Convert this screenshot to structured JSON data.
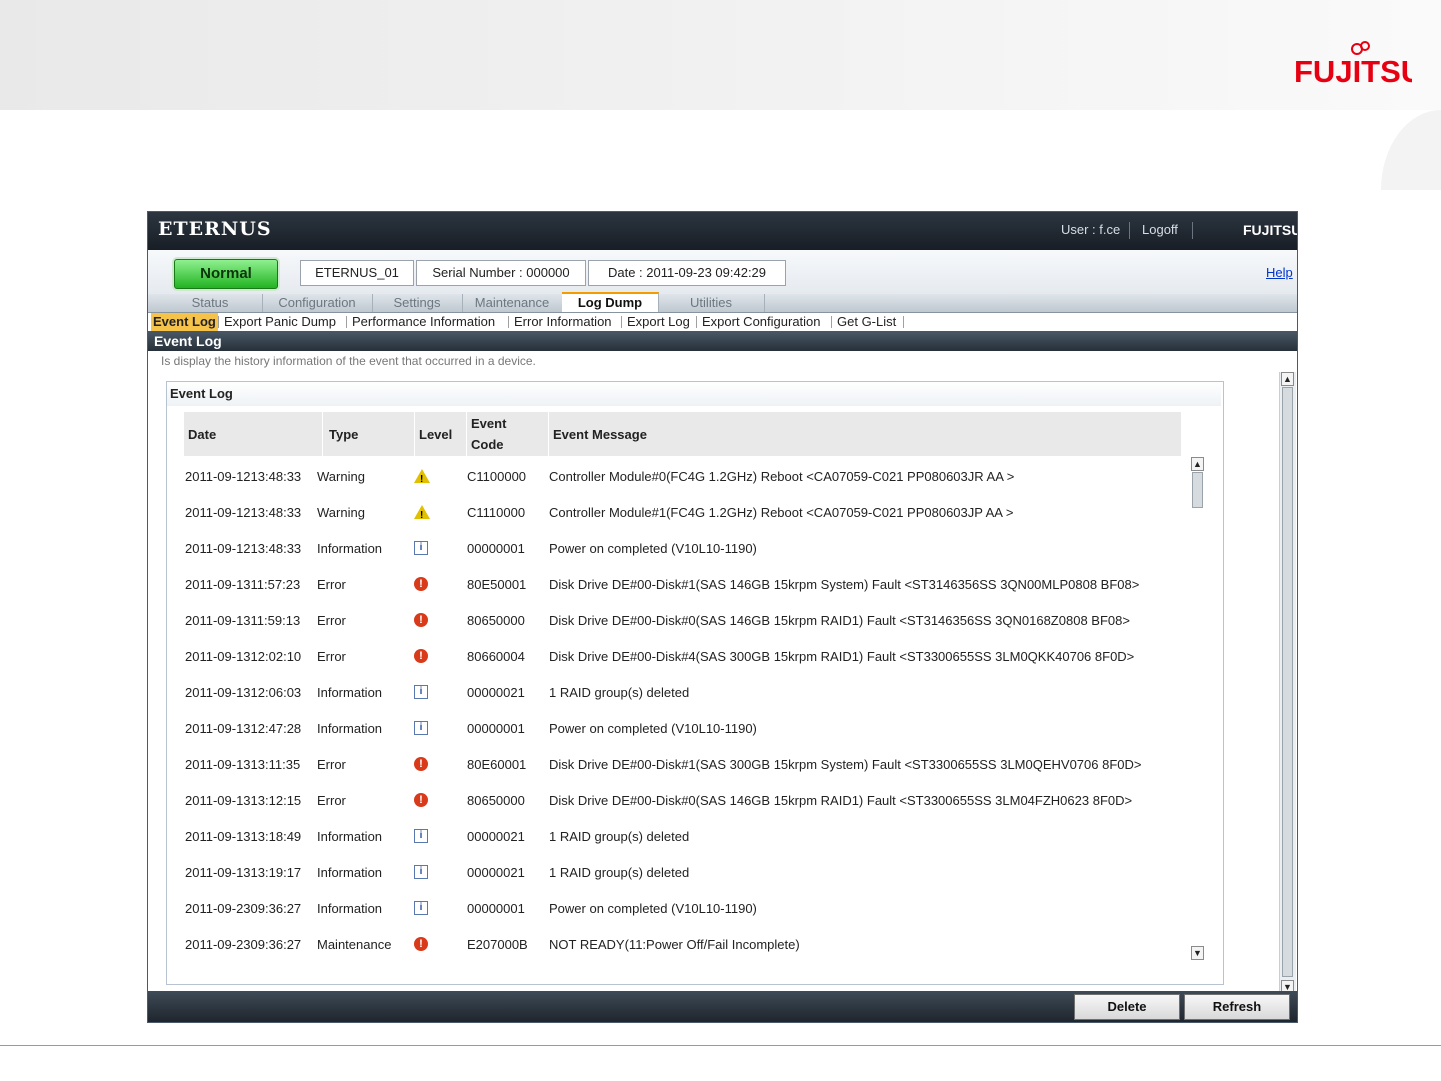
{
  "slide": {
    "logo": "FUJITSU"
  },
  "header": {
    "brand": "ETERNUS",
    "user": "User : f.ce",
    "logoff": "Logoff",
    "vendor": "FUJITSU"
  },
  "status": {
    "state": "Normal",
    "device": "ETERNUS_01",
    "serial": "Serial Number : 000000",
    "date": "Date : 2011-09-23 09:42:29",
    "help": "Help"
  },
  "tabs": [
    "Status",
    "Configuration",
    "Settings",
    "Maintenance",
    "Log Dump",
    "Utilities"
  ],
  "active_tab": "Log Dump",
  "subtabs": [
    "Event Log",
    "Export Panic Dump",
    "Performance Information",
    "Error Information",
    "Export Log",
    "Export Configuration",
    "Get G-List"
  ],
  "active_subtab": "Event Log",
  "section": {
    "title": "Event Log",
    "description": "Is display the history information of the event that occurred in a device."
  },
  "panel": {
    "title": "Event Log",
    "columns": {
      "date": "Date",
      "type": "Type",
      "level": "Level",
      "code_line1": "Event",
      "code_line2": "Code",
      "message": "Event Message"
    },
    "rows": [
      {
        "date1": "2011-09-12",
        "date2": "13:48:33",
        "type": "Warning",
        "level": "warning-icon",
        "code": "C1100000",
        "message": "Controller Module#0(FC4G 1.2GHz) Reboot <CA07059-C021 PP080603JR AA >"
      },
      {
        "date1": "2011-09-12",
        "date2": "13:48:33",
        "type": "Warning",
        "level": "warning-icon",
        "code": "C1110000",
        "message": "Controller Module#1(FC4G 1.2GHz) Reboot <CA07059-C021 PP080603JP AA >"
      },
      {
        "date1": "2011-09-12",
        "date2": "13:48:33",
        "type": "Information",
        "level": "info-icon",
        "code": "00000001",
        "message": "Power on completed (V10L10-1190)"
      },
      {
        "date1": "2011-09-13",
        "date2": "11:57:23",
        "type": "Error",
        "level": "error-icon",
        "code": "80E50001",
        "message": "Disk Drive DE#00-Disk#1(SAS 146GB 15krpm System) Fault <ST3146356SS 3QN00MLP0808 BF08>"
      },
      {
        "date1": "2011-09-13",
        "date2": "11:59:13",
        "type": "Error",
        "level": "error-icon",
        "code": "80650000",
        "message": "Disk Drive DE#00-Disk#0(SAS 146GB 15krpm RAID1) Fault <ST3146356SS 3QN0168Z0808 BF08>"
      },
      {
        "date1": "2011-09-13",
        "date2": "12:02:10",
        "type": "Error",
        "level": "error-icon",
        "code": "80660004",
        "message": "Disk Drive DE#00-Disk#4(SAS 300GB 15krpm RAID1) Fault <ST3300655SS 3LM0QKK40706 8F0D>"
      },
      {
        "date1": "2011-09-13",
        "date2": "12:06:03",
        "type": "Information",
        "level": "info-icon",
        "code": "00000021",
        "message": "1 RAID group(s) deleted"
      },
      {
        "date1": "2011-09-13",
        "date2": "12:47:28",
        "type": "Information",
        "level": "info-icon",
        "code": "00000001",
        "message": "Power on completed (V10L10-1190)"
      },
      {
        "date1": "2011-09-13",
        "date2": "13:11:35",
        "type": "Error",
        "level": "error-icon",
        "code": "80E60001",
        "message": "Disk Drive DE#00-Disk#1(SAS 300GB 15krpm System) Fault <ST3300655SS 3LM0QEHV0706 8F0D>"
      },
      {
        "date1": "2011-09-13",
        "date2": "13:12:15",
        "type": "Error",
        "level": "error-icon",
        "code": "80650000",
        "message": "Disk Drive DE#00-Disk#0(SAS 146GB 15krpm RAID1) Fault <ST3300655SS 3LM04FZH0623 8F0D>"
      },
      {
        "date1": "2011-09-13",
        "date2": "13:18:49",
        "type": "Information",
        "level": "info-icon",
        "code": "00000021",
        "message": "1 RAID group(s) deleted"
      },
      {
        "date1": "2011-09-13",
        "date2": "13:19:17",
        "type": "Information",
        "level": "info-icon",
        "code": "00000021",
        "message": "1 RAID group(s) deleted"
      },
      {
        "date1": "2011-09-23",
        "date2": "09:36:27",
        "type": "Information",
        "level": "info-icon",
        "code": "00000001",
        "message": "Power on completed (V10L10-1190)"
      },
      {
        "date1": "2011-09-23",
        "date2": "09:36:27",
        "type": "Maintenance",
        "level": "error-icon",
        "code": "E207000B",
        "message": "NOT READY(11:Power Off/Fail Incomplete)"
      }
    ]
  },
  "footer": {
    "delete": "Delete",
    "refresh": "Refresh"
  },
  "colors": {
    "status_normal": "#22b322",
    "active_tab_accent": "#f29c00",
    "active_subtab": "#f5c24a",
    "error": "#d83a1a",
    "warning": "#e0c000"
  }
}
